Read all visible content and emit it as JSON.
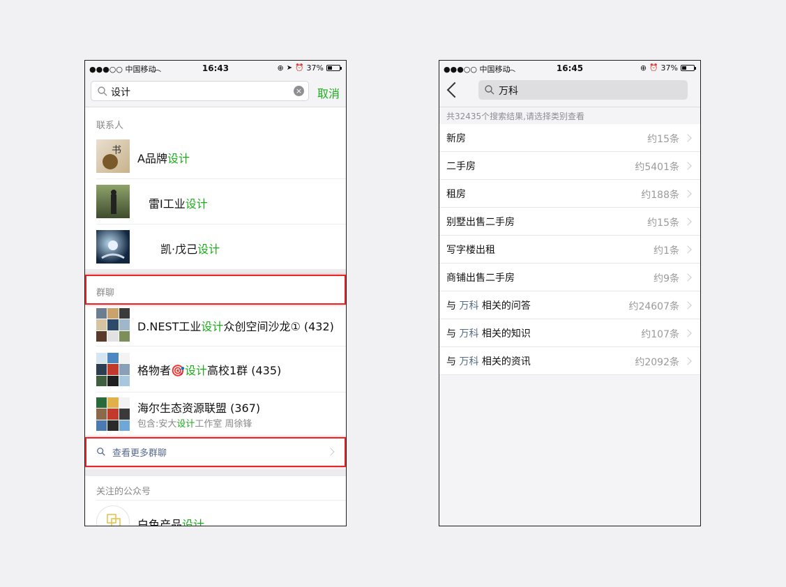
{
  "left": {
    "status": {
      "carrier": "●●●○○ 中国移动",
      "time": "16:43",
      "battery": "37%"
    },
    "search": {
      "query": "设计",
      "cancel_label": "取消"
    },
    "contacts": {
      "title": "联系人",
      "items": [
        {
          "prefix": "A品牌",
          "match": "设计"
        },
        {
          "prefix": "雷I工业",
          "match": "设计"
        },
        {
          "prefix": "凯·戊己",
          "match": "设计"
        }
      ]
    },
    "groups": {
      "title": "群聊",
      "items": [
        {
          "prefix": "D.NEST工业",
          "match": "设计",
          "suffix": "众创空间沙龙① (432)"
        },
        {
          "prefix": "格物者🎯",
          "match": "设计",
          "suffix": "高校1群 (435)"
        },
        {
          "prefix": "海尔生态资源联盟 (367)",
          "match": "",
          "suffix": "",
          "sub_prefix": "包含:安大",
          "sub_match": "设计",
          "sub_suffix": "工作室 周徐锋"
        }
      ],
      "more_label": "查看更多群聊"
    },
    "official": {
      "title": "关注的公众号",
      "items": [
        {
          "prefix": "白色产品",
          "match": "设计"
        }
      ]
    }
  },
  "right": {
    "status": {
      "carrier": "●●●○○ 中国移动",
      "time": "16:45",
      "battery": "37%"
    },
    "search": {
      "query": "万科"
    },
    "result_count": "共32435个搜索结果,请选择类别查看",
    "categories": [
      {
        "pre": "新房",
        "kw": "",
        "post": "",
        "count": "约15条"
      },
      {
        "pre": "二手房",
        "kw": "",
        "post": "",
        "count": "约5401条"
      },
      {
        "pre": "租房",
        "kw": "",
        "post": "",
        "count": "约188条"
      },
      {
        "pre": "别墅出售二手房",
        "kw": "",
        "post": "",
        "count": "约15条"
      },
      {
        "pre": "写字楼出租",
        "kw": "",
        "post": "",
        "count": "约1条"
      },
      {
        "pre": "商铺出售二手房",
        "kw": "",
        "post": "",
        "count": "约9条"
      },
      {
        "pre": "与 ",
        "kw": "万科",
        "post": " 相关的问答",
        "count": "约24607条"
      },
      {
        "pre": "与 ",
        "kw": "万科",
        "post": " 相关的知识",
        "count": "约107条"
      },
      {
        "pre": "与 ",
        "kw": "万科",
        "post": " 相关的资讯",
        "count": "约2092条"
      }
    ]
  },
  "colors": {
    "accent_green": "#1aad19",
    "link_blue": "#566a8e",
    "highlight_red": "#e8262a"
  }
}
